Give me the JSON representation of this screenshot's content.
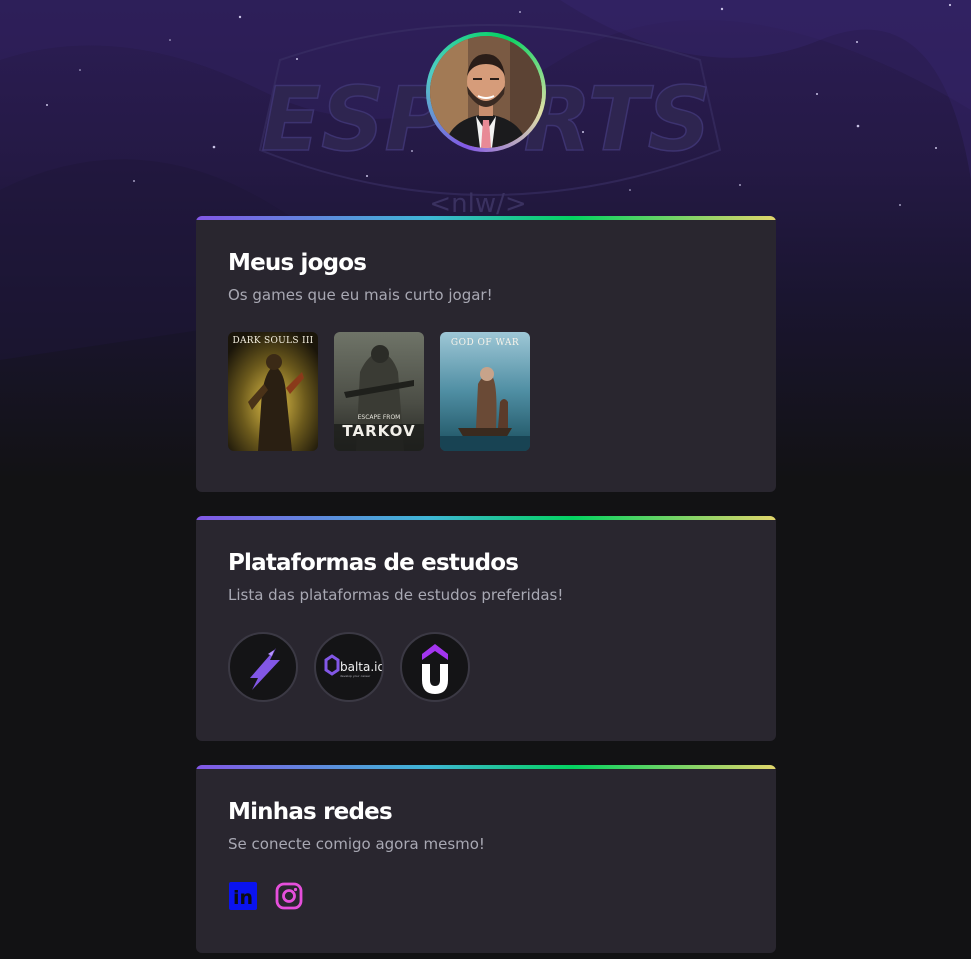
{
  "background": {
    "watermark_text": "ESPORTS",
    "watermark_sub": "<nlw/>"
  },
  "profile": {
    "avatar_alt": "Foto de perfil"
  },
  "sections": {
    "games": {
      "title": "Meus jogos",
      "subtitle": "Os games que eu mais curto jogar!",
      "items": [
        {
          "name": "DARK SOULS III",
          "cover_title": "DARK SOULS III"
        },
        {
          "name": "Escape from Tarkov",
          "cover_top": "ESCAPE FROM",
          "cover_bottom": "TARKOV"
        },
        {
          "name": "God of War",
          "cover_title": "GOD OF WAR"
        }
      ]
    },
    "platforms": {
      "title": "Plataformas de estudos",
      "subtitle": "Lista das plataformas de estudos preferidas!",
      "items": [
        {
          "name": "Rocketseat",
          "icon": "rocketseat-logo-icon"
        },
        {
          "name": "balta.io",
          "label": "balta.io",
          "tagline": "develop your career",
          "icon": "balta-logo-icon"
        },
        {
          "name": "Udemy",
          "icon": "udemy-logo-icon"
        }
      ]
    },
    "social": {
      "title": "Minhas redes",
      "subtitle": "Se conecte comigo agora mesmo!",
      "items": [
        {
          "name": "LinkedIn",
          "label": "in",
          "icon": "linkedin-icon",
          "color": "#0a13f0"
        },
        {
          "name": "Instagram",
          "icon": "instagram-icon",
          "color": "#e64fdc"
        }
      ]
    }
  },
  "colors": {
    "page_bg": "#121214",
    "card_bg": "#29262f",
    "title": "#ffffff",
    "subtitle": "#a8a8b3",
    "accent": "#8257e6"
  }
}
